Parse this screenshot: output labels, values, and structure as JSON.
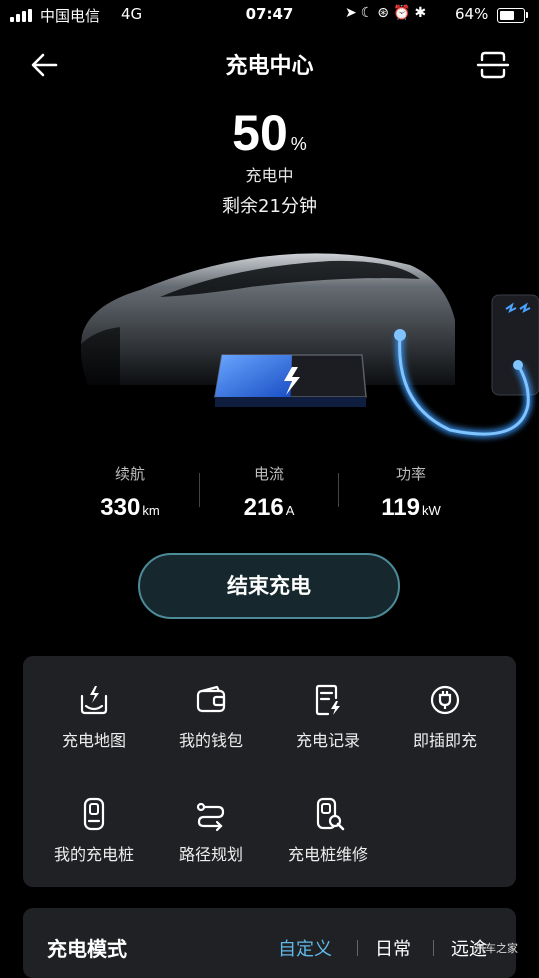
{
  "status_bar": {
    "carrier": "中国电信",
    "network": "4G",
    "time": "07:47",
    "battery_percent": "64%",
    "battery_level": 0.64,
    "icons": [
      "location-icon",
      "moon-icon",
      "lock-rotation-icon",
      "alarm-icon",
      "bluetooth-icon"
    ]
  },
  "header": {
    "title": "充电中心"
  },
  "charge": {
    "percent": "50",
    "percent_unit": "%",
    "state": "充电中",
    "remaining": "剩余21分钟",
    "level": 0.5
  },
  "stats": [
    {
      "label": "续航",
      "value": "330",
      "unit": "km"
    },
    {
      "label": "电流",
      "value": "216",
      "unit": "A"
    },
    {
      "label": "功率",
      "value": "119",
      "unit": "kW"
    }
  ],
  "stop_button": "结束充电",
  "functions": [
    {
      "label": "充电地图",
      "icon": "map-charge-icon"
    },
    {
      "label": "我的钱包",
      "icon": "wallet-icon"
    },
    {
      "label": "充电记录",
      "icon": "record-icon"
    },
    {
      "label": "即插即充",
      "icon": "plug-icon"
    },
    {
      "label": "我的充电桩",
      "icon": "charger-pile-icon"
    },
    {
      "label": "路径规划",
      "icon": "route-icon"
    },
    {
      "label": "充电桩维修",
      "icon": "repair-icon"
    }
  ],
  "mode": {
    "title": "充电模式",
    "tabs": [
      "自定义",
      "日常",
      "远途"
    ],
    "active_tab": 0,
    "accent": "#5fb8e8"
  },
  "watermark": "汽车之家",
  "colors": {
    "accent": "#5fb8e8",
    "cable": "#3d9bff",
    "battery_fill": "#2f6ee0"
  }
}
